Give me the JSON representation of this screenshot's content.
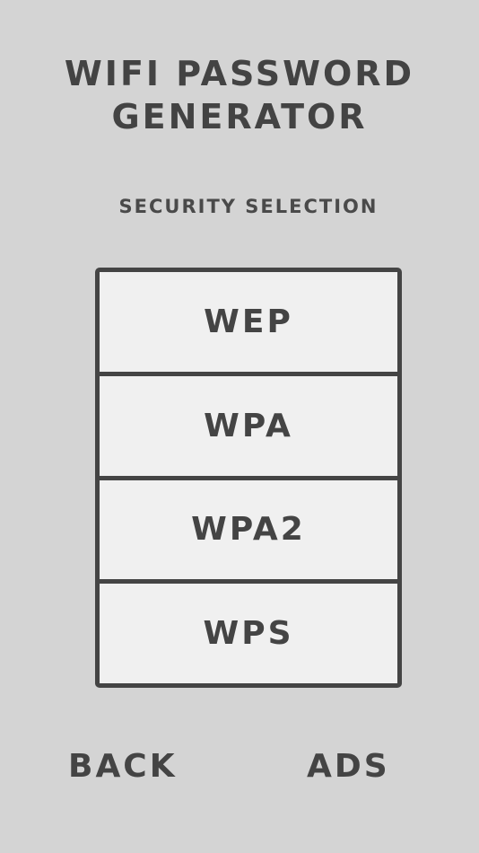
{
  "app": {
    "title_line1": "WIFI PASSWORD",
    "title_line2": "GENERATOR"
  },
  "security": {
    "heading": "SECURITY SELECTION",
    "options": [
      {
        "label": "WEP"
      },
      {
        "label": "WPA"
      },
      {
        "label": "WPA2"
      },
      {
        "label": "WPS"
      }
    ]
  },
  "footer": {
    "back_label": "BACK",
    "ads_label": "ADS"
  },
  "colors": {
    "background": "#d4d4d4",
    "panel": "#f0f0f0",
    "text": "#444444"
  }
}
